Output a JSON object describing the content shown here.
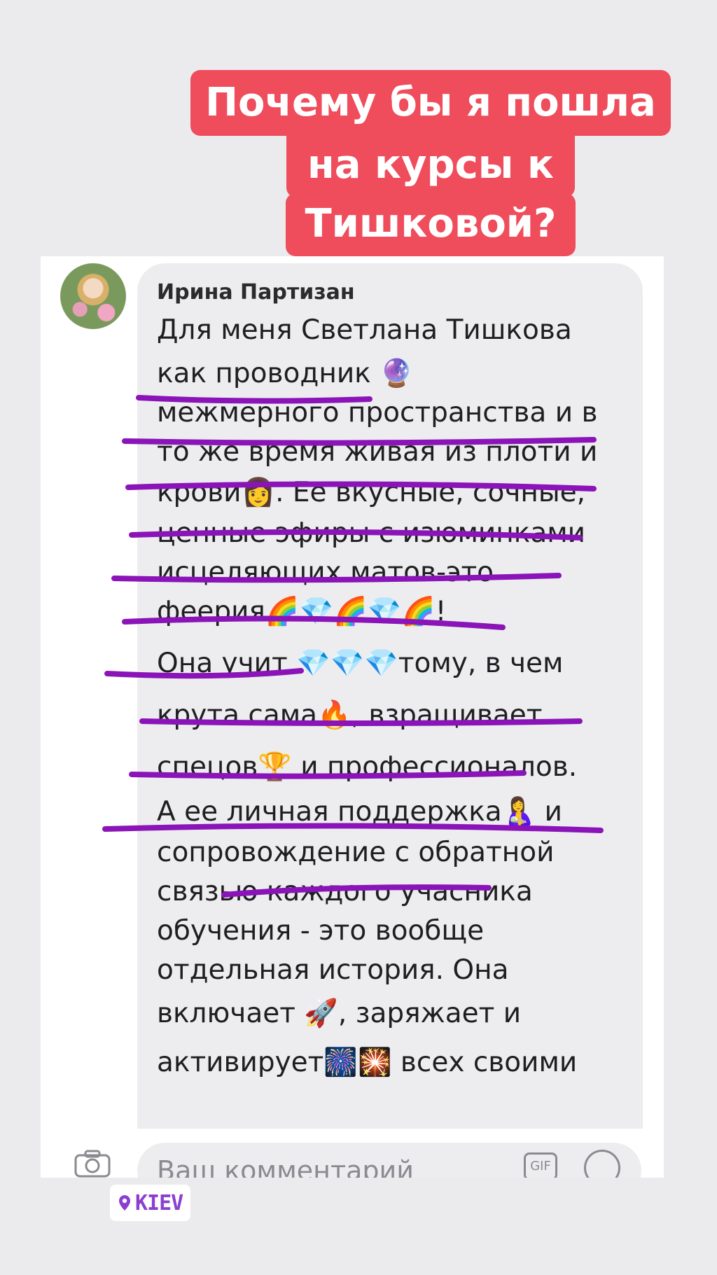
{
  "title_lines": [
    "Почему бы я пошла",
    "на курсы к",
    "Тишковой?"
  ],
  "comment": {
    "author": "Ирина Партизан",
    "lines": [
      "Для меня Светлана Тишкова",
      "как проводник 🔮",
      "межмерного пространства и в",
      "то же время живая из плоти и",
      "крови👩. Ее вкусные, сочные,",
      "ценные эфиры с изюминками",
      "исцеляющих матов-это",
      "феерия🌈💎🌈💎🌈!",
      "Она учит 💎💎💎тому, в чем",
      "крута сама🔥, взращивает",
      "спецов🏆 и профессионалов.",
      "А ее личная поддержка🤱 и",
      "сопровождение с обратной",
      "связью каждого учасника",
      "обучения - это вообще",
      "отдельная история. Она",
      "включает 🚀,  заряжает и",
      "активирует🎆🎇 всех своими"
    ]
  },
  "input": {
    "placeholder": "Ваш комментарий",
    "gif_label": "GIF"
  },
  "location": {
    "label": "KIEV"
  },
  "colors": {
    "banner": "#ef4c5c",
    "underline": "#8b14b8",
    "location_text": "#8a3fd0"
  }
}
